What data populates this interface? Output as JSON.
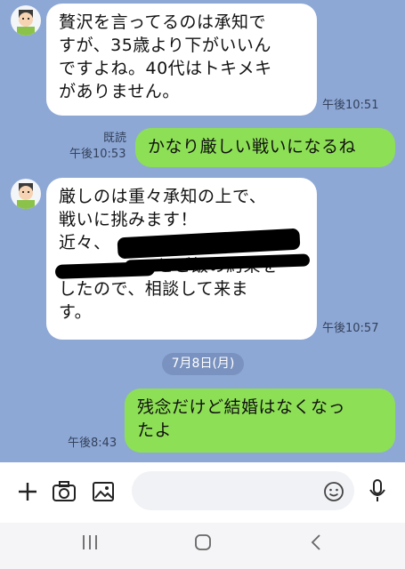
{
  "messages": [
    {
      "side": "left",
      "text": "贅沢を言ってるのは承知で\nすが、35歳より下がいいん\nですよね。40代はトキメキ\nがありません。",
      "time": "午後10:51"
    },
    {
      "side": "right",
      "text": "かなり厳しい戦いになるね",
      "read": "既読",
      "time": "午後10:53"
    },
    {
      "side": "left",
      "text_line1": "厳しのは重々承知の上で、",
      "text_line2": "戦いに挑みます！",
      "text_line3": "近々、",
      "text_line4": "とご飯の約束を",
      "text_line5": "したので、相談して来ま",
      "text_line6": "す。",
      "time": "午後10:57"
    },
    {
      "side": "right",
      "text": "残念だけど結婚はなくなっ\nたよ",
      "time": "午後8:43"
    }
  ],
  "date_separator": "7月8日(月)",
  "input": {
    "placeholder": ""
  },
  "colors": {
    "chat_bg": "#8ea8d6",
    "outgoing": "#8de055",
    "incoming": "#ffffff"
  }
}
